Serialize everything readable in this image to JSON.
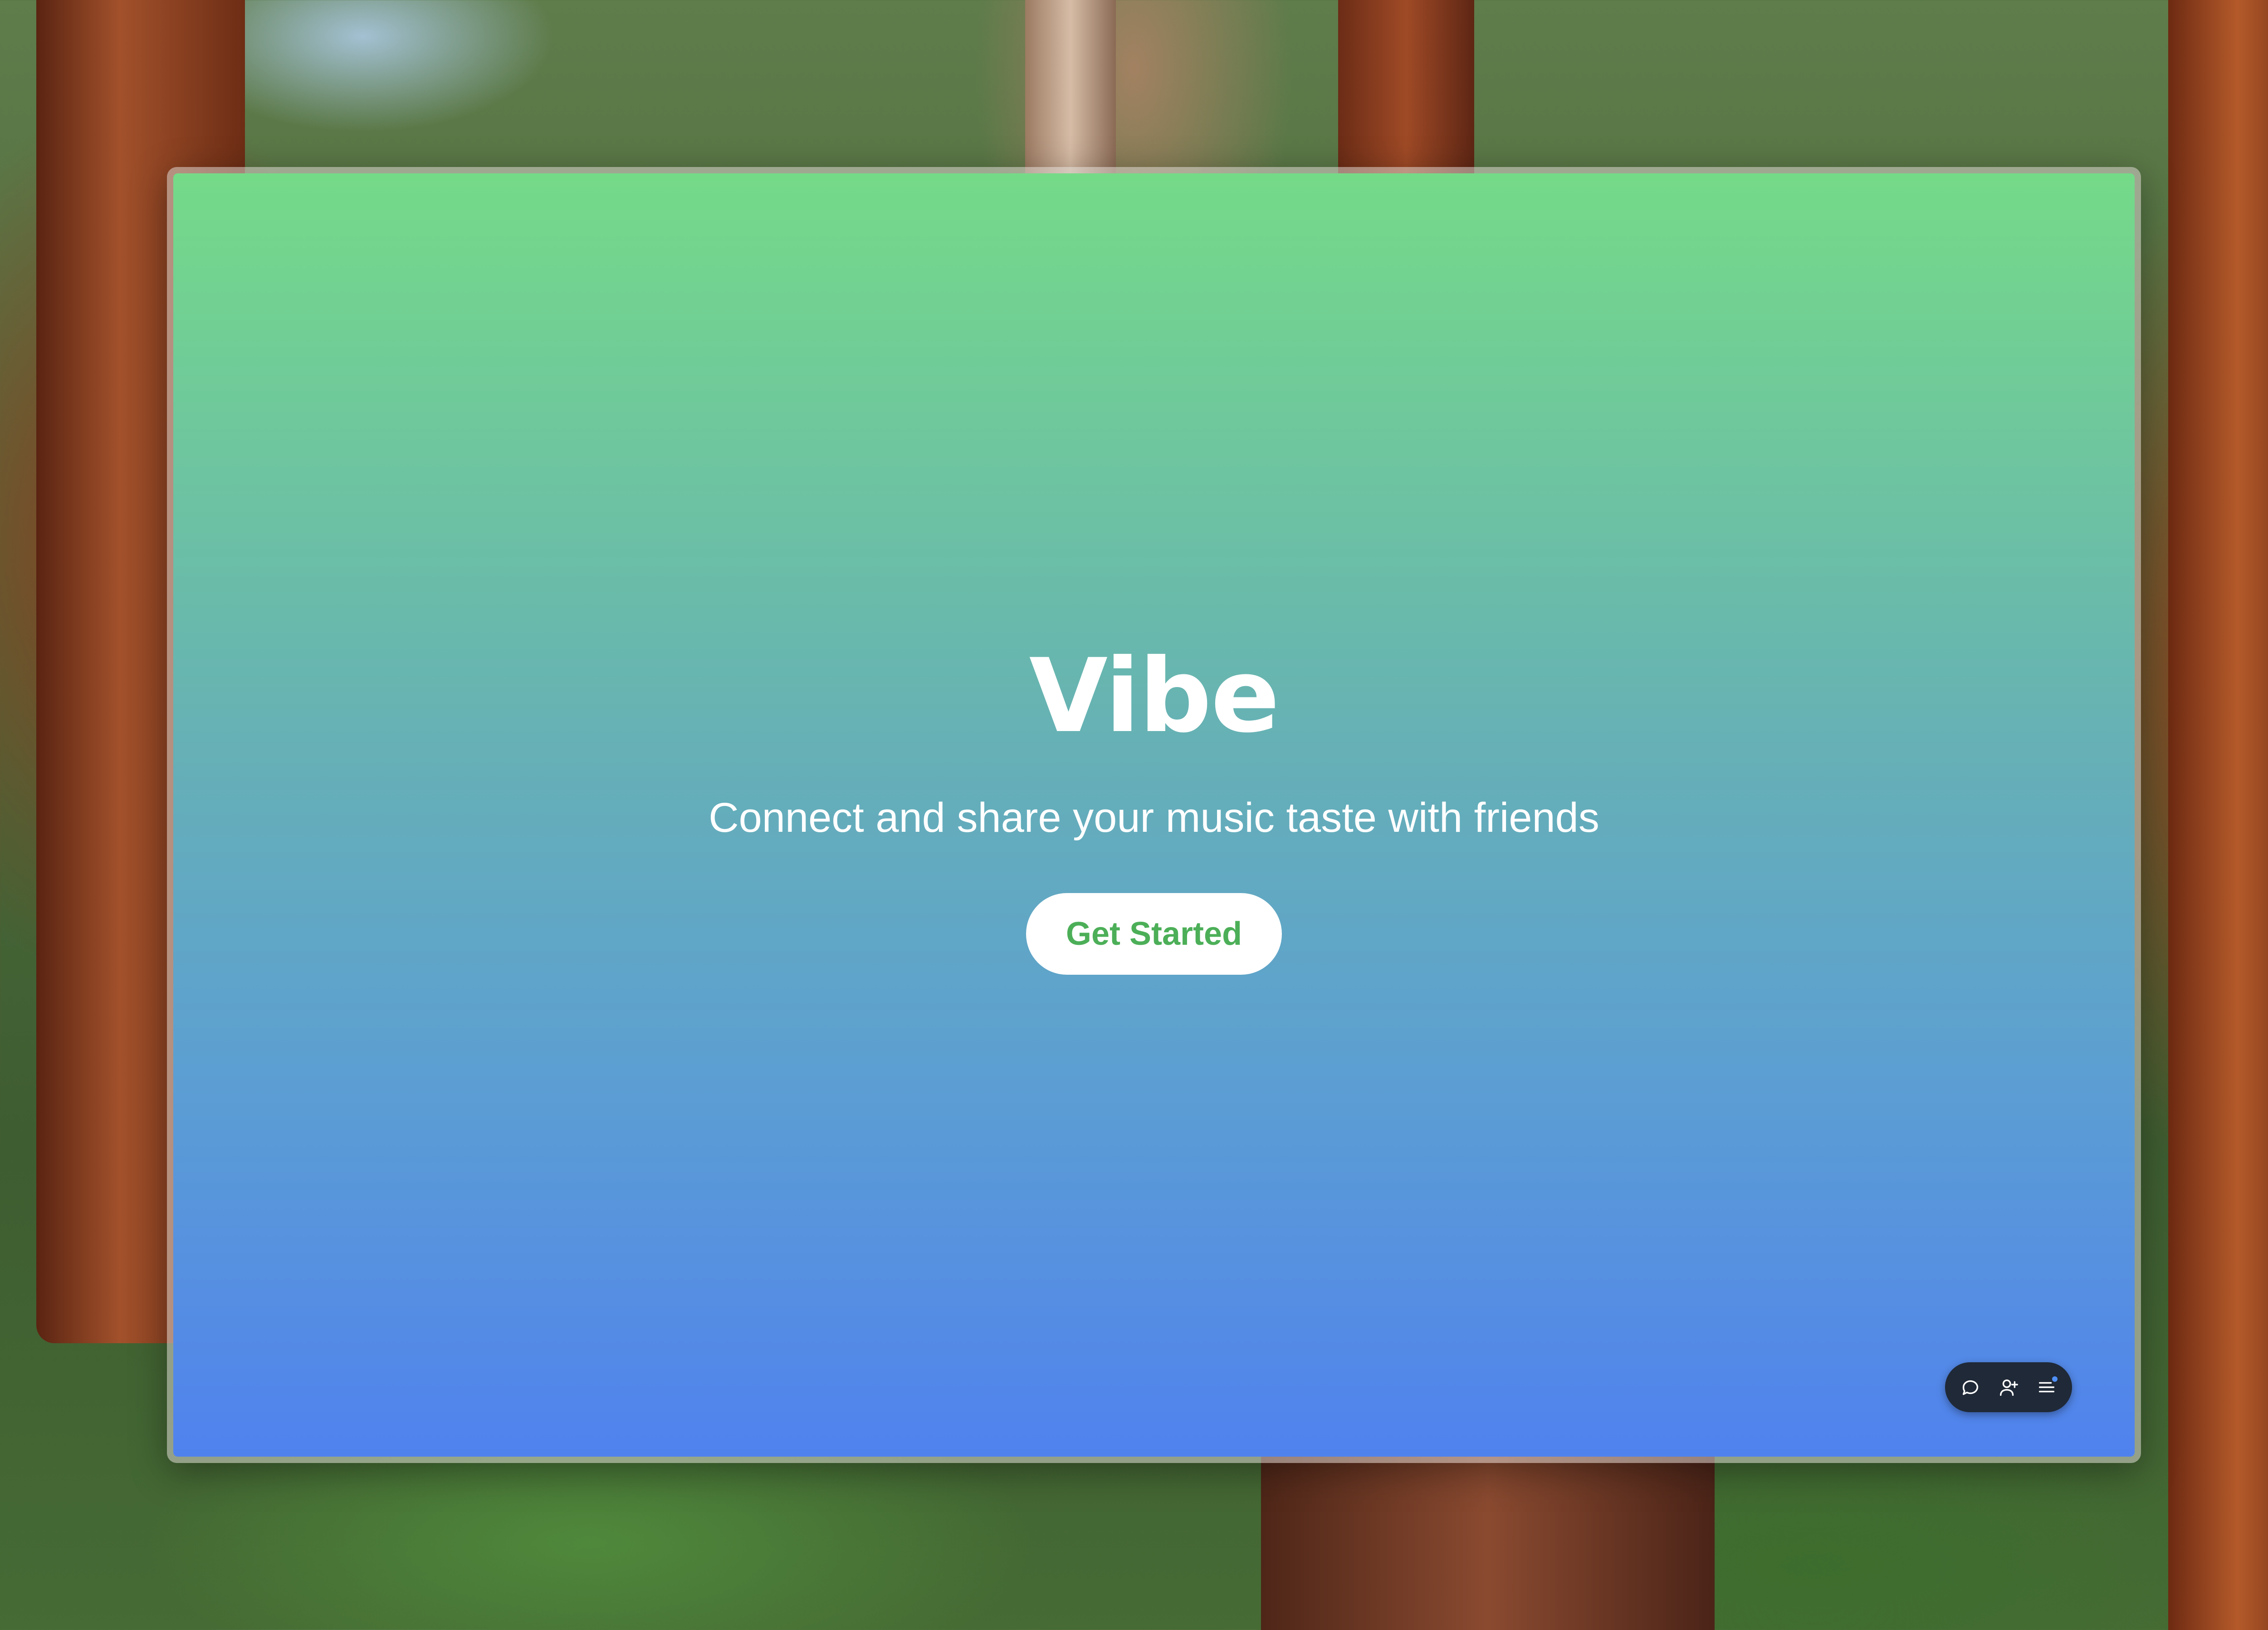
{
  "app": {
    "title": "Vibe",
    "subtitle": "Connect and share your music taste with friends",
    "cta_label": "Get Started"
  },
  "toolbar": {
    "items": [
      {
        "icon": "chat-bubble-icon"
      },
      {
        "icon": "add-user-icon"
      },
      {
        "icon": "menu-list-icon"
      }
    ]
  },
  "colors": {
    "gradient_top": "#75da88",
    "gradient_bottom": "#5082ee",
    "cta_text": "#4caf58",
    "toolbar_bg": "#1f2937",
    "notification_dot": "#4f8ff7"
  }
}
